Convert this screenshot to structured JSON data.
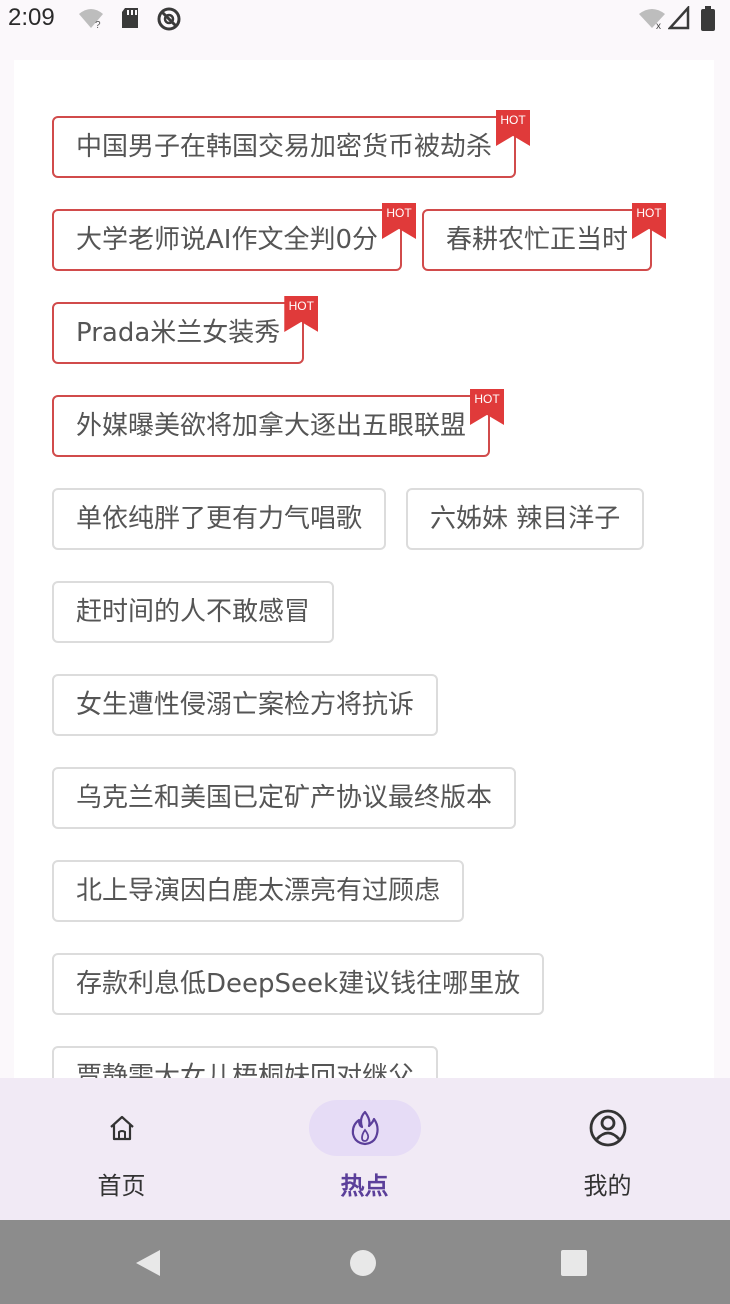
{
  "status_bar": {
    "time": "2:09",
    "left_icons": [
      "wifi-question-icon",
      "sd-card-icon",
      "do-not-disturb-icon"
    ],
    "right_icons": [
      "wifi-off-icon",
      "cellular-signal-icon",
      "battery-icon"
    ]
  },
  "hot_tags": [
    {
      "label": "中国男子在韩国交易加密货币被劫杀",
      "hot": true
    },
    {
      "label": "大学老师说AI作文全判0分",
      "hot": true
    },
    {
      "label": "春耕农忙正当时",
      "hot": true
    },
    {
      "label": "Prada米兰女装秀",
      "hot": true
    },
    {
      "label": "外媒曝美欲将加拿大逐出五眼联盟",
      "hot": true
    },
    {
      "label": "单依纯胖了更有力气唱歌",
      "hot": false
    },
    {
      "label": "六姊妹 辣目洋子",
      "hot": false
    },
    {
      "label": "赶时间的人不敢感冒",
      "hot": false
    },
    {
      "label": "女生遭性侵溺亡案检方将抗诉",
      "hot": false
    },
    {
      "label": "乌克兰和美国已定矿产协议最终版本",
      "hot": false
    },
    {
      "label": "北上导演因白鹿太漂亮有过顾虑",
      "hot": false
    },
    {
      "label": "存款利息低DeepSeek建议钱往哪里放",
      "hot": false
    },
    {
      "label": "贾静雯大女儿梧桐妹回对继父",
      "hot": false
    }
  ],
  "hot_badge_text": "HOT",
  "bottom_nav": {
    "items": [
      {
        "label": "首页",
        "icon": "home-icon",
        "active": false
      },
      {
        "label": "热点",
        "icon": "flame-icon",
        "active": true
      },
      {
        "label": "我的",
        "icon": "profile-icon",
        "active": false
      }
    ]
  },
  "colors": {
    "hot_border": "#d14b4b",
    "hot_badge": "#e03a3a",
    "nav_active_bg": "#e6dcf6",
    "nav_active_text": "#5b3f9a",
    "nav_bg": "#f1eaf5"
  }
}
